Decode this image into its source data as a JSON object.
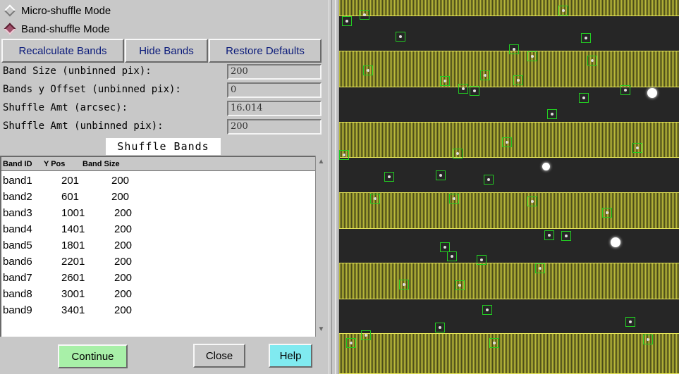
{
  "modes": {
    "micro_label": "Micro-shuffle Mode",
    "band_label": "Band-shuffle Mode",
    "selected": "band"
  },
  "buttons": {
    "recalculate": "Recalculate Bands",
    "hide": "Hide Bands",
    "restore": "Restore Defaults"
  },
  "fields": [
    {
      "label": "Band Size (unbinned pix):",
      "value": "200"
    },
    {
      "label": "Bands y Offset (unbinned pix):",
      "value": "0"
    },
    {
      "label": "Shuffle Amt (arcsec):",
      "value": "16.014"
    },
    {
      "label": "Shuffle Amt (unbinned pix):",
      "value": "200"
    }
  ],
  "table": {
    "title": "Shuffle Bands",
    "headers": [
      "Band ID",
      "Y Pos",
      "Band Size"
    ],
    "rows": [
      [
        "band1",
        "201",
        "200"
      ],
      [
        "band2",
        "601",
        "200"
      ],
      [
        "band3",
        "1001",
        "200"
      ],
      [
        "band4",
        "1401",
        "200"
      ],
      [
        "band5",
        "1801",
        "200"
      ],
      [
        "band6",
        "2201",
        "200"
      ],
      [
        "band7",
        "2601",
        "200"
      ],
      [
        "band8",
        "3001",
        "200"
      ],
      [
        "band9",
        "3401",
        "200"
      ]
    ]
  },
  "footer": {
    "continue": "Continue",
    "close": "Close",
    "help": "Help"
  },
  "colors": {
    "panel_bg": "#c8c8c8",
    "button_text": "#0a1a7a",
    "continue_bg": "#a8f0a8",
    "help_bg": "#80eaf0",
    "band_overlay": "#b9b93a",
    "object_box": "#22cc22",
    "radio_selected": "#a0506a"
  },
  "icons": {
    "radio_off": "radio-diamond-unselected-icon",
    "radio_on": "radio-diamond-selected-icon",
    "scroll_up": "scroll-up-arrow-icon",
    "scroll_down": "scroll-down-arrow-icon"
  }
}
